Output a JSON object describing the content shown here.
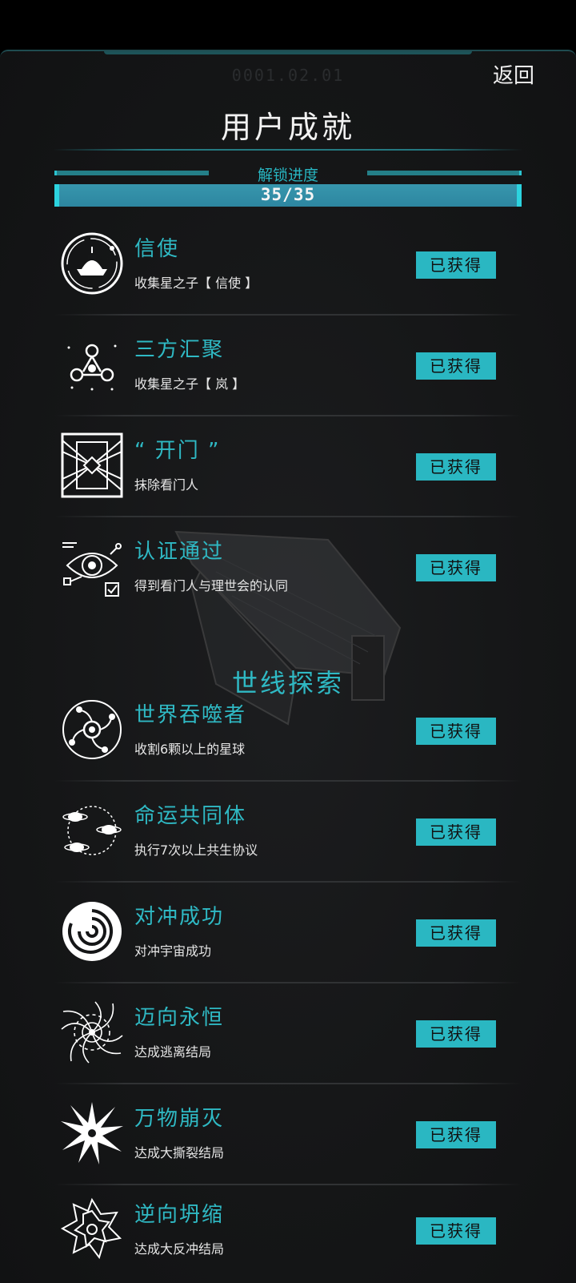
{
  "header": {
    "date": "0001.02.01",
    "back_label": "返回",
    "title": "用户成就"
  },
  "progress": {
    "label": "解锁进度",
    "text": "35/35",
    "fraction": 1.0
  },
  "section_title": "世线探索",
  "achievements": [
    {
      "name": "信使",
      "desc": "收集星之子【 信使 】",
      "status": "已获得",
      "icon": "messenger-icon"
    },
    {
      "name": "三方汇聚",
      "desc": "收集星之子【 岚 】",
      "status": "已获得",
      "icon": "triad-gather-icon"
    },
    {
      "name": "“ 开门 ”",
      "desc": "抹除看门人",
      "status": "已获得",
      "icon": "open-door-icon"
    },
    {
      "name": "认证通过",
      "desc": "得到看门人与理世会的认同",
      "status": "已获得",
      "icon": "eye-verify-icon"
    },
    {
      "name": "世界吞噬者",
      "desc": "收割6颗以上的星球",
      "status": "已获得",
      "icon": "world-devourer-icon"
    },
    {
      "name": "命运共同体",
      "desc": "执行7次以上共生协议",
      "status": "已获得",
      "icon": "orbit-planets-icon"
    },
    {
      "name": "对冲成功",
      "desc": "对冲宇宙成功",
      "status": "已获得",
      "icon": "swirl-icon"
    },
    {
      "name": "迈向永恒",
      "desc": "达成逃离结局",
      "status": "已获得",
      "icon": "vortex-icon"
    },
    {
      "name": "万物崩灭",
      "desc": "达成大撕裂结局",
      "status": "已获得",
      "icon": "burst-icon"
    },
    {
      "name": "逆向坍缩",
      "desc": "达成大反冲结局",
      "status": "已获得",
      "icon": "snowflake-icon"
    }
  ],
  "colors": {
    "accent": "#2fb9c4",
    "badge_bg": "#2ab7c2",
    "background": "#151617"
  }
}
